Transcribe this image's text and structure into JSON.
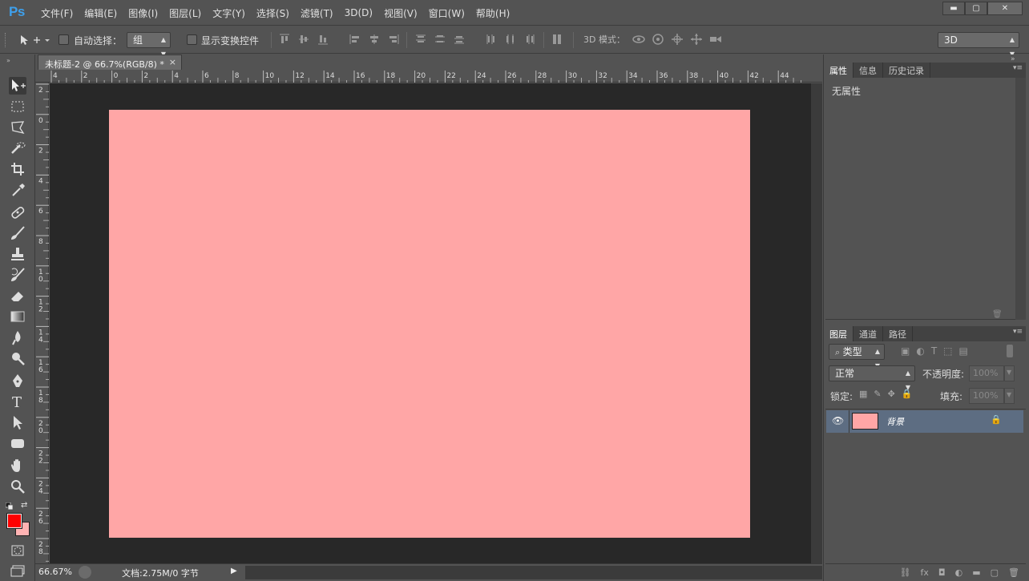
{
  "app": {
    "logo": "Ps"
  },
  "menubar": {
    "items": [
      "文件(F)",
      "编辑(E)",
      "图像(I)",
      "图层(L)",
      "文字(Y)",
      "选择(S)",
      "滤镜(T)",
      "3D(D)",
      "视图(V)",
      "窗口(W)",
      "帮助(H)"
    ]
  },
  "window_controls": {
    "minimize": "▬",
    "maximize": "▢",
    "close": "✕"
  },
  "options_bar": {
    "auto_select_label": "自动选择：",
    "auto_select_value": "组",
    "show_transform_label": "显示变换控件",
    "mode_3d_label": "3D 模式：",
    "workspace_value": "3D"
  },
  "document": {
    "tab_title": "未标题-2 @ 66.7%(RGB/8) *",
    "tab_close": "×",
    "canvas_color": "#ffa6a6",
    "ruler_top_labels": [
      "4",
      "2",
      "0",
      "2",
      "4",
      "6",
      "8",
      "10",
      "12",
      "14",
      "16",
      "18",
      "20",
      "22",
      "24",
      "26",
      "28",
      "30",
      "32",
      "34",
      "36",
      "38",
      "40",
      "42",
      "44"
    ],
    "ruler_left_labels": [
      "2",
      "0",
      "2",
      "4",
      "6",
      "8",
      "1 0",
      "1 2",
      "1 4",
      "1 6",
      "1 8",
      "2 0",
      "2 2",
      "2 4",
      "2 6",
      "2 8"
    ]
  },
  "status_bar": {
    "zoom": "66.67%",
    "doc_info": "文档:2.75M/0 字节"
  },
  "colors": {
    "foreground": "#ff0000",
    "background": "#ffb3b3",
    "accent": "#3ea0ec"
  },
  "properties_panel": {
    "tabs": [
      "属性",
      "信息",
      "历史记录"
    ],
    "content": "无属性"
  },
  "layers_panel": {
    "tabs": [
      "图层",
      "通道",
      "路径"
    ],
    "filter_label": "类型",
    "blend_mode": "正常",
    "opacity_label": "不透明度:",
    "opacity_value": "100%",
    "lock_label": "锁定:",
    "fill_label": "填充:",
    "fill_value": "100%",
    "layers": [
      {
        "name": "背景",
        "color": "#ffa6a6"
      }
    ]
  }
}
